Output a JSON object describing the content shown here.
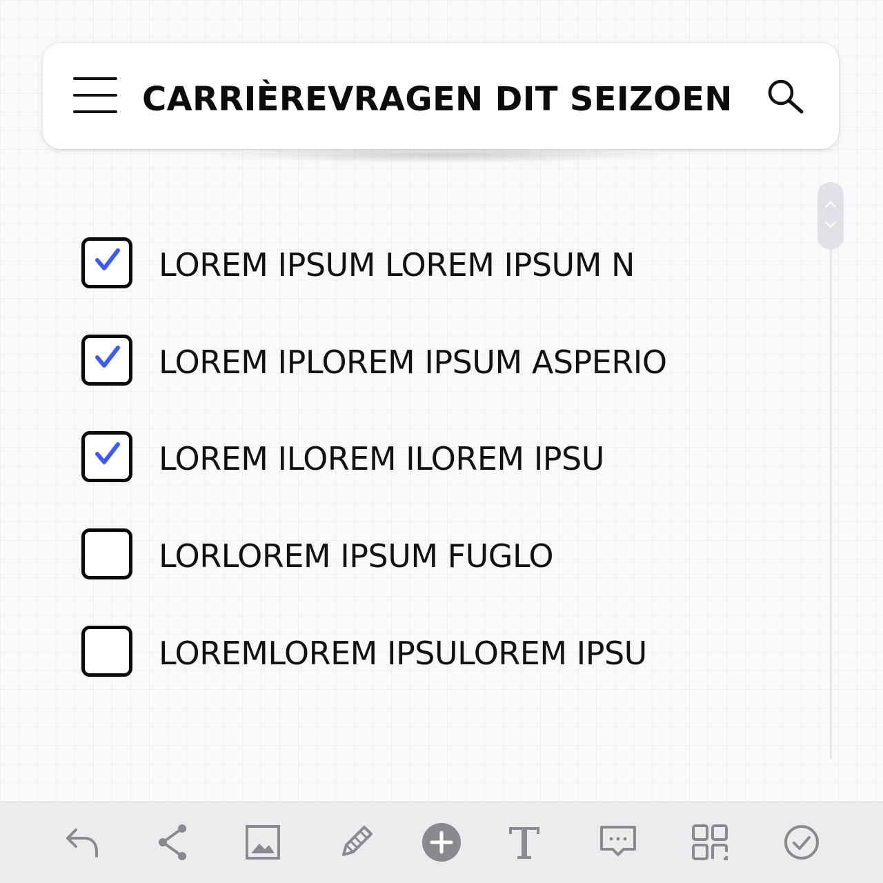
{
  "header": {
    "title": "CARRIÈREVRAGEN DIT SEIZOEN",
    "menu_icon": "hamburger-menu-icon",
    "search_icon": "search-icon"
  },
  "checklist": {
    "items": [
      {
        "label": "LOREM IPSUM LOREM IPSUM N",
        "checked": true
      },
      {
        "label": "LOREM IPLOREM IPSUM ASPERIO",
        "checked": true
      },
      {
        "label": "LOREM ILOREM ILOREM IPSU",
        "checked": true
      },
      {
        "label": "LORLOREM IPSUM FUGLO",
        "checked": false
      },
      {
        "label": "LOREMLOREM IPSULOREM IPSU",
        "checked": false
      }
    ]
  },
  "colors": {
    "check_accent": "#3d5cf5",
    "toolbar_icon": "#8a8a8e",
    "toolbar_bg": "#ececee"
  },
  "toolbar": {
    "tools": [
      {
        "icon": "undo-icon"
      },
      {
        "icon": "share-icon"
      },
      {
        "icon": "image-icon"
      },
      {
        "icon": "pencil-icon"
      },
      {
        "icon": "add-circle-icon"
      },
      {
        "icon": "text-icon"
      },
      {
        "icon": "comment-icon"
      },
      {
        "icon": "grid-layout-icon"
      },
      {
        "icon": "check-circle-icon"
      }
    ]
  }
}
